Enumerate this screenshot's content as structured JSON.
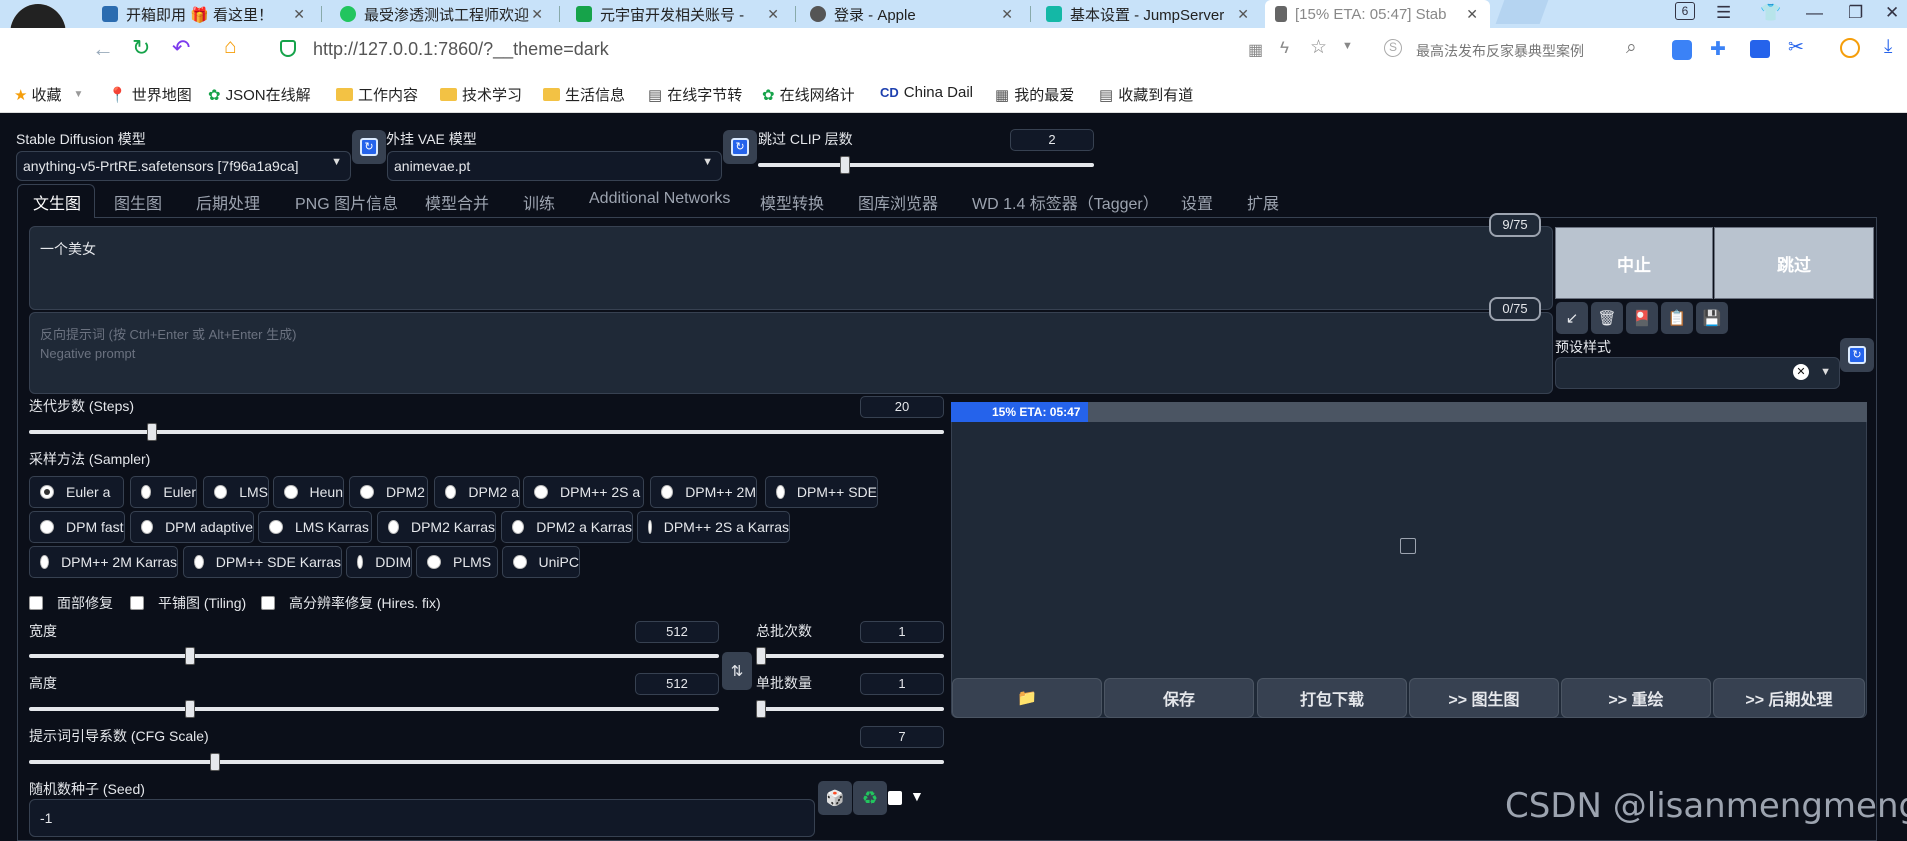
{
  "browser": {
    "tabs": [
      {
        "title": "开箱即用 🎁 看这里！"
      },
      {
        "title": "最受渗透测试工程师欢迎"
      },
      {
        "title": "元宇宙开发相关账号 - "
      },
      {
        "title": "登录 - Apple"
      },
      {
        "title": "基本设置 - JumpServer"
      },
      {
        "title": "[15% ETA: 05:47] Stab"
      }
    ],
    "tab_count": "6",
    "url": "http://127.0.0.1:7860/?__theme=dark",
    "search_hint": "最高法发布反家暴典型案例",
    "bookmarks": [
      "收藏",
      "世界地图",
      "JSON在线解",
      "工作内容",
      "技术学习",
      "生活信息",
      "在线字节转",
      "在线网络计",
      "China Dail",
      "我的最爱",
      "收藏到有道"
    ]
  },
  "top": {
    "sd_model_label": "Stable Diffusion 模型",
    "sd_model_value": "anything-v5-PrtRE.safetensors [7f96a1a9ca]",
    "vae_label": "外挂 VAE 模型",
    "vae_value": "animevae.pt",
    "clip_label": "跳过 CLIP 层数",
    "clip_value": "2",
    "clip_level": 0.25
  },
  "main_tabs": [
    "文生图",
    "图生图",
    "后期处理",
    "PNG 图片信息",
    "模型合并",
    "训练",
    "Additional Networks",
    "模型转换",
    "图库浏览器",
    "WD 1.4 标签器（Tagger）",
    "设置",
    "扩展"
  ],
  "prompt": {
    "text": "一个美女",
    "count": "9/75",
    "neg_placeholder_1": "反向提示词 (按 Ctrl+Enter 或 Alt+Enter 生成)",
    "neg_placeholder_2": "Negative prompt",
    "neg_count": "0/75"
  },
  "actions": {
    "interrupt": "中止",
    "skip": "跳过",
    "tools": [
      "↙",
      "🗑",
      "🎴",
      "📋",
      "💾"
    ],
    "styles_label": "预设样式"
  },
  "steps": {
    "label": "迭代步数 (Steps)",
    "value": "20",
    "level": 0.13
  },
  "sampler": {
    "label": "采样方法 (Sampler)",
    "selected": "Euler a",
    "options": [
      "Euler a",
      "Euler",
      "LMS",
      "Heun",
      "DPM2",
      "DPM2 a",
      "DPM++ 2S a",
      "DPM++ 2M",
      "DPM++ SDE",
      "DPM fast",
      "DPM adaptive",
      "LMS Karras",
      "DPM2 Karras",
      "DPM2 a Karras",
      "DPM++ 2S a Karras",
      "DPM++ 2M Karras",
      "DPM++ SDE Karras",
      "DDIM",
      "PLMS",
      "UniPC"
    ]
  },
  "checks": [
    "面部修复",
    "平铺图 (Tiling)",
    "高分辨率修复 (Hires. fix)"
  ],
  "width": {
    "label": "宽度",
    "value": "512",
    "level": 0.23
  },
  "height": {
    "label": "高度",
    "value": "512",
    "level": 0.23
  },
  "batch_count": {
    "label": "总批次数",
    "value": "1",
    "level": 0.0
  },
  "batch_size": {
    "label": "单批数量",
    "value": "1",
    "level": 0.0
  },
  "swap_icon": "⇅",
  "cfg": {
    "label": "提示词引导系数 (CFG Scale)",
    "value": "7",
    "level": 0.2
  },
  "seed": {
    "label": "随机数种子 (Seed)",
    "value": "-1",
    "dice": "🎲",
    "recycle": "♻",
    "extra": "▼"
  },
  "output": {
    "progress_text": "15% ETA: 05:47",
    "progress": 0.15,
    "buttons": [
      "📁",
      "保存",
      "打包下载",
      ">> 图生图",
      ">> 重绘",
      ">> 后期处理"
    ]
  },
  "watermark": "CSDN @lisanmengmeng"
}
